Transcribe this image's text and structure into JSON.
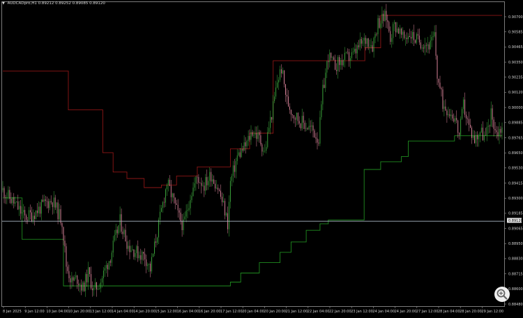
{
  "header": {
    "symbol_label": "AUDCADpro,H1",
    "open": "0.89212",
    "high": "0.89252",
    "low": "0.89085",
    "close": "0.89120"
  },
  "price_marker": "0.89120",
  "icons": {
    "collapse": "triangle-down-icon",
    "zoom": "magnifier-plus-icon"
  },
  "colors": {
    "background": "#000000",
    "bull_candle": "#3fae3f",
    "bear_candle": "#e58aa2",
    "upper_channel": "#8e1616",
    "lower_channel": "#1f8c1f",
    "price_line": "#a9b6c4"
  },
  "chart_data": {
    "type": "candlestick",
    "timeframe": "H1",
    "price_scale": [
      "0.90700",
      "0.90585",
      "0.90465",
      "0.90350",
      "0.90235",
      "0.90120",
      "0.90000",
      "0.89885",
      "0.89765",
      "0.89650",
      "0.89530",
      "0.89415",
      "0.89300",
      "0.89185",
      "0.89065",
      "0.88950",
      "0.88830",
      "0.88715",
      "0.88600",
      "0.88480"
    ],
    "ylim": [
      0.8846,
      0.9074
    ],
    "time_scale": [
      "8 Jan 2025",
      "9 Jan 12:00",
      "10 Jan 04:00",
      "10 Jan 20:00",
      "13 Jan 12:00",
      "14 Jan 04:00",
      "14 Jan 20:00",
      "15 Jan 12:00",
      "16 Jan 04:00",
      "16 Jan 20:00",
      "17 Jan 12:00",
      "20 Jan 04:00",
      "20 Jan 20:00",
      "21 Jan 12:00",
      "22 Jan 04:00",
      "22 Jan 20:00",
      "23 Jan 12:00",
      "24 Jan 04:00",
      "24 Jan 20:00",
      "27 Jan 12:00",
      "28 Jan 04:00",
      "28 Jan 20:00",
      "29 Jan 12:00"
    ],
    "current_price": 0.8912,
    "close_path": [
      [
        0,
        0.8936
      ],
      [
        18,
        0.8925
      ],
      [
        32,
        0.8915
      ],
      [
        45,
        0.8918
      ],
      [
        62,
        0.8926
      ],
      [
        72,
        0.8928
      ],
      [
        86,
        0.8912
      ],
      [
        92,
        0.8878
      ],
      [
        100,
        0.8865
      ],
      [
        108,
        0.8868
      ],
      [
        116,
        0.886
      ],
      [
        124,
        0.8872
      ],
      [
        132,
        0.8858
      ],
      [
        142,
        0.8866
      ],
      [
        156,
        0.8885
      ],
      [
        170,
        0.8912
      ],
      [
        182,
        0.8893
      ],
      [
        194,
        0.8888
      ],
      [
        206,
        0.8885
      ],
      [
        214,
        0.8875
      ],
      [
        222,
        0.8898
      ],
      [
        230,
        0.892
      ],
      [
        238,
        0.8942
      ],
      [
        246,
        0.893
      ],
      [
        254,
        0.8917
      ],
      [
        262,
        0.8908
      ],
      [
        272,
        0.8932
      ],
      [
        282,
        0.8946
      ],
      [
        292,
        0.894
      ],
      [
        302,
        0.8948
      ],
      [
        312,
        0.8938
      ],
      [
        322,
        0.892
      ],
      [
        326,
        0.891
      ],
      [
        330,
        0.8942
      ],
      [
        340,
        0.8962
      ],
      [
        352,
        0.897
      ],
      [
        362,
        0.8982
      ],
      [
        372,
        0.8976
      ],
      [
        380,
        0.8965
      ],
      [
        386,
        0.8985
      ],
      [
        392,
        0.9
      ],
      [
        398,
        0.902
      ],
      [
        404,
        0.903
      ],
      [
        412,
        0.9005
      ],
      [
        420,
        0.8996
      ],
      [
        430,
        0.899
      ],
      [
        440,
        0.8986
      ],
      [
        450,
        0.8982
      ],
      [
        458,
        0.8975
      ],
      [
        464,
        0.9012
      ],
      [
        472,
        0.904
      ],
      [
        480,
        0.9032
      ],
      [
        490,
        0.9035
      ],
      [
        498,
        0.9038
      ],
      [
        508,
        0.904
      ],
      [
        518,
        0.9048
      ],
      [
        528,
        0.9053
      ],
      [
        536,
        0.9048
      ],
      [
        544,
        0.9066
      ],
      [
        550,
        0.9068
      ],
      [
        556,
        0.907
      ],
      [
        562,
        0.9055
      ],
      [
        568,
        0.9064
      ],
      [
        574,
        0.906
      ],
      [
        580,
        0.9053
      ],
      [
        590,
        0.9057
      ],
      [
        600,
        0.9052
      ],
      [
        610,
        0.905
      ],
      [
        620,
        0.9048
      ],
      [
        626,
        0.9055
      ],
      [
        630,
        0.9025
      ],
      [
        638,
        0.9003
      ],
      [
        646,
        0.8998
      ],
      [
        656,
        0.8992
      ],
      [
        662,
        0.8978
      ],
      [
        668,
        0.9002
      ],
      [
        676,
        0.8985
      ],
      [
        684,
        0.8975
      ],
      [
        692,
        0.8982
      ],
      [
        700,
        0.8976
      ],
      [
        708,
        0.8995
      ],
      [
        716,
        0.898
      ],
      [
        724,
        0.8985
      ]
    ],
    "upper_channel": [
      [
        0,
        0.9028
      ],
      [
        95,
        0.9028
      ],
      [
        95,
        0.8998
      ],
      [
        145,
        0.8998
      ],
      [
        145,
        0.8965
      ],
      [
        160,
        0.8965
      ],
      [
        160,
        0.895
      ],
      [
        180,
        0.895
      ],
      [
        180,
        0.8945
      ],
      [
        205,
        0.8945
      ],
      [
        205,
        0.8938
      ],
      [
        230,
        0.8938
      ],
      [
        230,
        0.894
      ],
      [
        252,
        0.894
      ],
      [
        252,
        0.8947
      ],
      [
        282,
        0.8947
      ],
      [
        282,
        0.8954
      ],
      [
        330,
        0.8954
      ],
      [
        330,
        0.8968
      ],
      [
        358,
        0.8968
      ],
      [
        358,
        0.898
      ],
      [
        392,
        0.898
      ],
      [
        392,
        0.9036
      ],
      [
        525,
        0.9036
      ],
      [
        525,
        0.9046
      ],
      [
        548,
        0.9046
      ],
      [
        548,
        0.9071
      ],
      [
        724,
        0.9071
      ]
    ],
    "lower_channel": [
      [
        0,
        0.893
      ],
      [
        28,
        0.893
      ],
      [
        28,
        0.8898
      ],
      [
        88,
        0.8898
      ],
      [
        88,
        0.8862
      ],
      [
        330,
        0.8862
      ],
      [
        330,
        0.8865
      ],
      [
        345,
        0.8865
      ],
      [
        345,
        0.8872
      ],
      [
        372,
        0.8872
      ],
      [
        372,
        0.888
      ],
      [
        402,
        0.888
      ],
      [
        402,
        0.8888
      ],
      [
        418,
        0.8888
      ],
      [
        418,
        0.8896
      ],
      [
        440,
        0.8896
      ],
      [
        440,
        0.8905
      ],
      [
        460,
        0.8905
      ],
      [
        460,
        0.891
      ],
      [
        472,
        0.891
      ],
      [
        472,
        0.8913
      ],
      [
        524,
        0.8913
      ],
      [
        524,
        0.8952
      ],
      [
        548,
        0.8952
      ],
      [
        548,
        0.8958
      ],
      [
        578,
        0.8958
      ],
      [
        578,
        0.8962
      ],
      [
        588,
        0.8962
      ],
      [
        588,
        0.8974
      ],
      [
        655,
        0.8974
      ],
      [
        655,
        0.8978
      ],
      [
        724,
        0.8978
      ]
    ]
  }
}
